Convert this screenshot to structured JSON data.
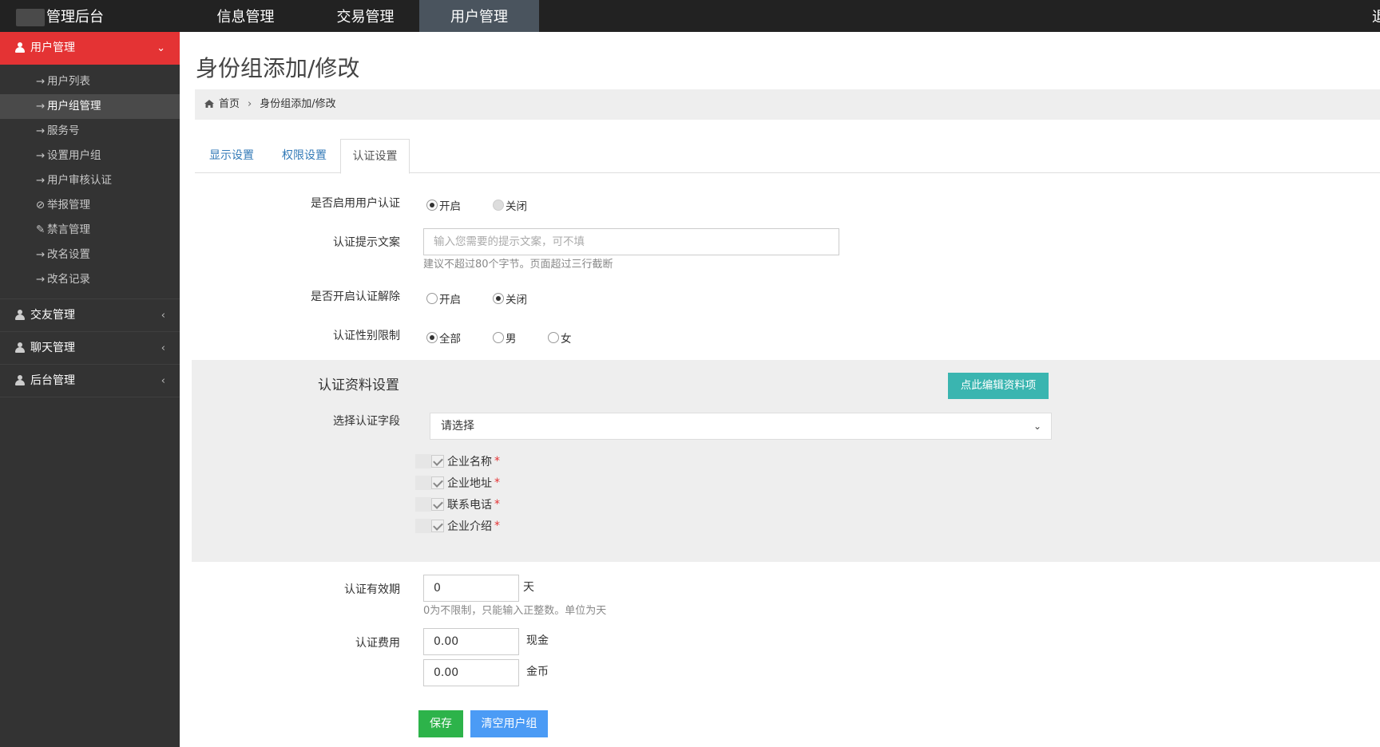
{
  "topbar": {
    "logo": "管理后台",
    "nav": [
      "信息管理",
      "交易管理",
      "用户管理"
    ],
    "right": "退"
  },
  "sidebar": {
    "groups": [
      {
        "label": "用户管理",
        "chevron": "⌄"
      },
      {
        "label": "交友管理",
        "chevron": "‹"
      },
      {
        "label": "聊天管理",
        "chevron": "‹"
      },
      {
        "label": "后台管理",
        "chevron": "‹"
      }
    ],
    "items": [
      {
        "icon": "→",
        "label": "用户列表"
      },
      {
        "icon": "→",
        "label": "用户组管理"
      },
      {
        "icon": "→",
        "label": "服务号"
      },
      {
        "icon": "→",
        "label": "设置用户组"
      },
      {
        "icon": "→",
        "label": "用户审核认证"
      },
      {
        "icon": "⊘",
        "label": "举报管理"
      },
      {
        "icon": "✎",
        "label": "禁言管理"
      },
      {
        "icon": "→",
        "label": "改名设置"
      },
      {
        "icon": "→",
        "label": "改名记录"
      }
    ]
  },
  "page": {
    "title": "身份组添加/修改",
    "breadcrumb": {
      "home": "首页",
      "sep": "›",
      "current": "身份组添加/修改"
    },
    "tabs": [
      "显示设置",
      "权限设置",
      "认证设置"
    ]
  },
  "form": {
    "enable_auth": {
      "label": "是否启用用户认证",
      "options": [
        "开启",
        "关闭"
      ],
      "selected": "开启"
    },
    "auth_tip": {
      "label": "认证提示文案",
      "placeholder": "输入您需要的提示文案，可不填",
      "help": "建议不超过80个字节。页面超过三行截断"
    },
    "auth_release": {
      "label": "是否开启认证解除",
      "options": [
        "开启",
        "关闭"
      ],
      "selected": "关闭"
    },
    "gender_limit": {
      "label": "认证性别限制",
      "options": [
        "全部",
        "男",
        "女"
      ],
      "selected": "全部"
    },
    "profile": {
      "title": "认证资料设置",
      "edit_button": "点此编辑资料项",
      "field_label": "选择认证字段",
      "select_value": "请选择",
      "fields": [
        "企业名称",
        "企业地址",
        "联系电话",
        "企业介绍"
      ],
      "required_mark": "*"
    },
    "validity": {
      "label": "认证有效期",
      "value": "0",
      "unit": "天",
      "help": "0为不限制，只能输入正整数。单位为天"
    },
    "fee": {
      "label": "认证费用",
      "cash": "0.00",
      "cash_unit": "现金",
      "coin": "0.00",
      "coin_unit": "金币"
    },
    "save_button": "保存",
    "clear_button": "清空用户组"
  },
  "colors": {
    "active_sidebar": "#e43334",
    "save": "#2db34a",
    "clear": "#4b9bf5",
    "edit": "#3ab5b0"
  }
}
